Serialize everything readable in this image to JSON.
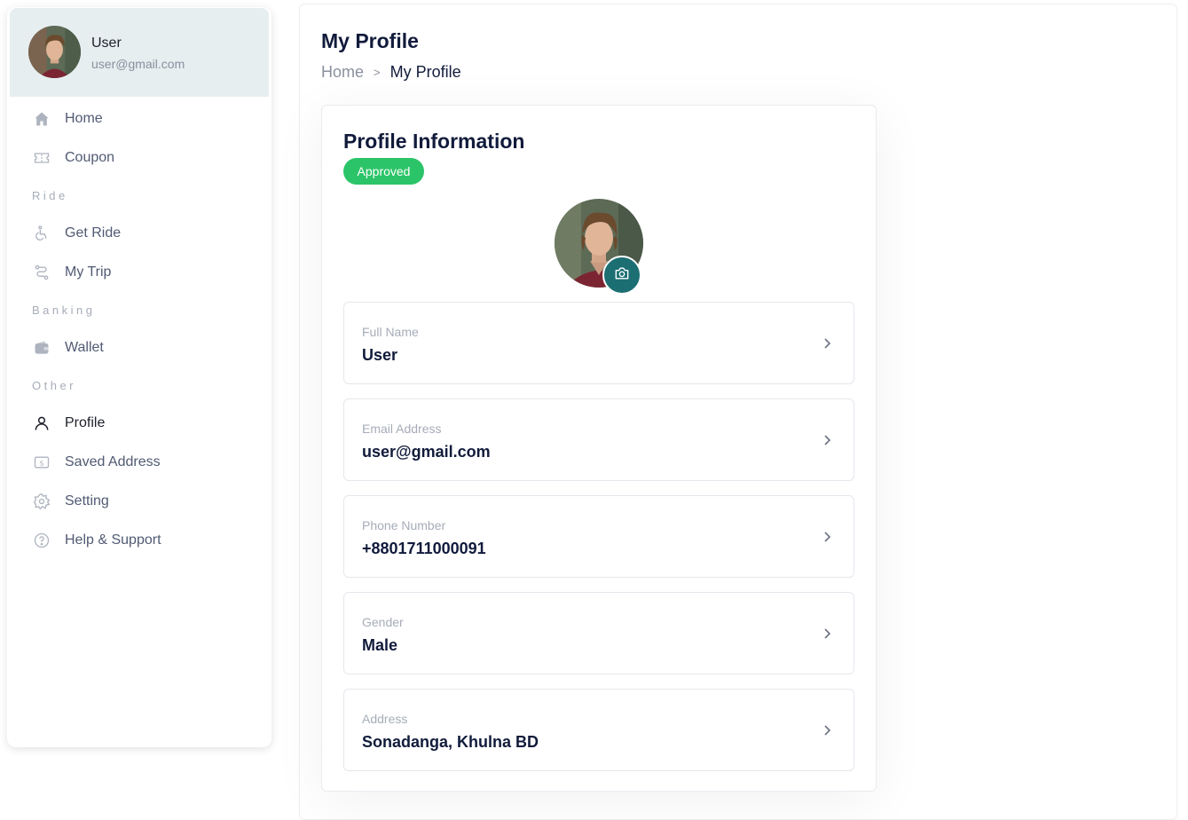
{
  "user": {
    "name": "User",
    "email": "user@gmail.com"
  },
  "sidebar": {
    "items": [
      {
        "type": "item",
        "label": "Home",
        "icon": "home-icon"
      },
      {
        "type": "item",
        "label": "Coupon",
        "icon": "ticket-icon"
      },
      {
        "type": "section",
        "label": "Ride"
      },
      {
        "type": "item",
        "label": "Get Ride",
        "icon": "accessible-icon"
      },
      {
        "type": "item",
        "label": "My Trip",
        "icon": "route-icon"
      },
      {
        "type": "section",
        "label": "Banking"
      },
      {
        "type": "item",
        "label": "Wallet",
        "icon": "wallet-icon"
      },
      {
        "type": "section",
        "label": "Other"
      },
      {
        "type": "item",
        "label": "Profile",
        "icon": "user-icon",
        "active": true
      },
      {
        "type": "item",
        "label": "Saved Address",
        "icon": "dollar-box-icon"
      },
      {
        "type": "item",
        "label": "Setting",
        "icon": "gear-icon"
      },
      {
        "type": "item",
        "label": "Help & Support",
        "icon": "question-circle-icon"
      }
    ]
  },
  "header": {
    "title": "My Profile",
    "breadcrumb": {
      "home": "Home",
      "separator": ">",
      "current": "My Profile"
    }
  },
  "profile": {
    "title": "Profile Information",
    "status": "Approved",
    "fields": [
      {
        "label": "Full Name",
        "value": "User"
      },
      {
        "label": "Email Address",
        "value": "user@gmail.com"
      },
      {
        "label": "Phone Number",
        "value": "+8801711000091"
      },
      {
        "label": "Gender",
        "value": "Male"
      },
      {
        "label": "Address",
        "value": "Sonadanga, Khulna BD"
      }
    ]
  },
  "colors": {
    "accent": "#1b6f73",
    "status_approved": "#2cc468",
    "user_card_bg": "#e6eef0",
    "text_dark": "#111b3b",
    "text_muted": "#a6acb8"
  }
}
